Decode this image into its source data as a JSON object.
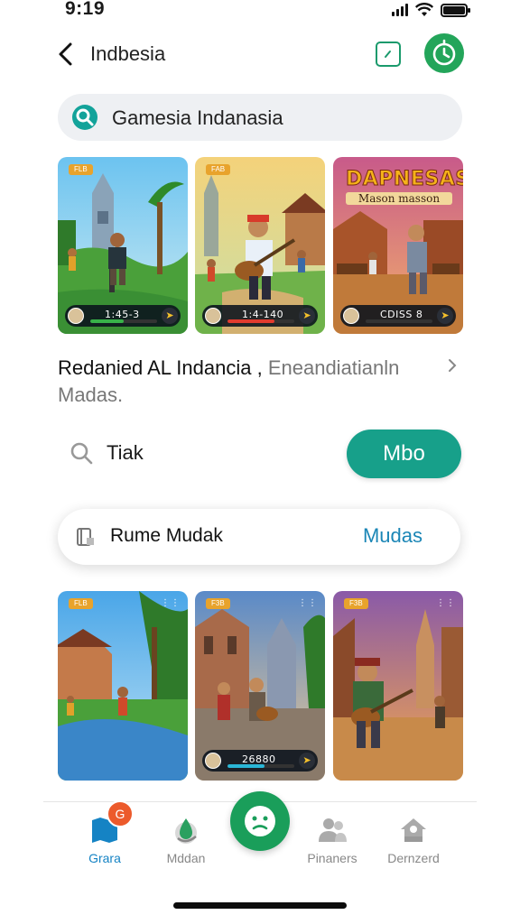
{
  "status_bar": {
    "time": "9:19"
  },
  "header": {
    "title": "Indbesia"
  },
  "search": {
    "text": "Gamesia Indanasia"
  },
  "featured_cards": [
    {
      "badge": "FLB",
      "stat": "1:45-3",
      "progress": 0.5,
      "progress_color": "#38b249"
    },
    {
      "badge": "FAB",
      "stat": "1:4-140",
      "progress": 0.7,
      "progress_color": "#e23b2e"
    },
    {
      "banner_title": "DAPNESAS",
      "banner_subtitle": "Mason masson",
      "stat": "CDISS 8",
      "progress": 0.0,
      "progress_color": "#444444"
    }
  ],
  "section": {
    "title": "Redanied AL Indancia ,",
    "subtitle": "Eneandiatianln Madas."
  },
  "filter": {
    "label": "Tiak",
    "button_label": "Mbo"
  },
  "pill": {
    "label": "Rume Mudak",
    "link": "Mudas"
  },
  "grid_cards": [
    {
      "badge": "FLB"
    },
    {
      "badge": "F3B"
    },
    {
      "badge": "F3B",
      "stat": "26880",
      "progress": 0.55,
      "progress_color": "#2ab6d6"
    },
    {
      "badge": "F3B"
    }
  ],
  "tab_bar": {
    "notification_badge": "G",
    "items": [
      {
        "label": "Grara",
        "active": true
      },
      {
        "label": "Mddan",
        "active": false
      },
      {
        "label": "Pinaners",
        "active": false
      },
      {
        "label": "Dernzerd",
        "active": false
      }
    ]
  },
  "colors": {
    "primary_teal": "#17a08a",
    "accent_green": "#23a55a",
    "link_blue": "#1b86b6",
    "active_tab": "#1583c4"
  }
}
